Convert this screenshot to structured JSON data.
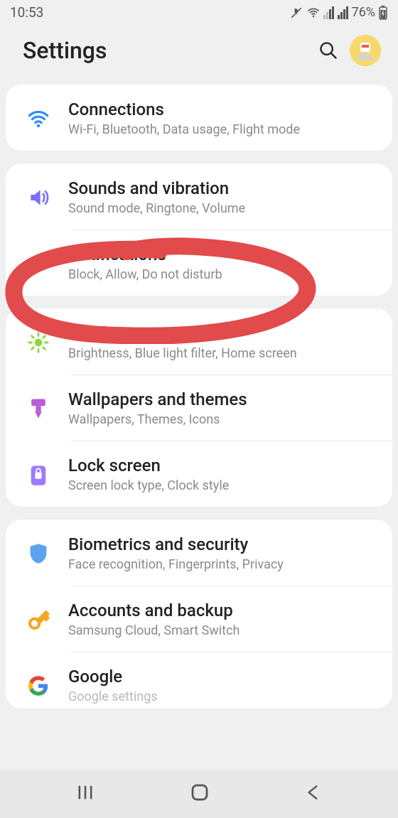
{
  "status": {
    "time": "10:53",
    "battery": "76%"
  },
  "header": {
    "title": "Settings"
  },
  "groups": [
    {
      "items": [
        {
          "icon": "wifi",
          "title": "Connections",
          "sub": "Wi-Fi, Bluetooth, Data usage, Flight mode"
        }
      ]
    },
    {
      "items": [
        {
          "icon": "sound",
          "title": "Sounds and vibration",
          "sub": "Sound mode, Ringtone, Volume"
        },
        {
          "icon": "notif",
          "title": "Notifications",
          "sub": "Block, Allow, Do not disturb"
        }
      ]
    },
    {
      "items": [
        {
          "icon": "display",
          "title": "Display",
          "sub": "Brightness, Blue light filter, Home screen"
        },
        {
          "icon": "wallpaper",
          "title": "Wallpapers and themes",
          "sub": "Wallpapers, Themes, Icons"
        },
        {
          "icon": "lock",
          "title": "Lock screen",
          "sub": "Screen lock type, Clock style"
        }
      ]
    },
    {
      "items": [
        {
          "icon": "shield",
          "title": "Biometrics and security",
          "sub": "Face recognition, Fingerprints, Privacy"
        },
        {
          "icon": "key",
          "title": "Accounts and backup",
          "sub": "Samsung Cloud, Smart Switch"
        },
        {
          "icon": "google",
          "title": "Google",
          "sub": "Google settings"
        }
      ]
    }
  ]
}
